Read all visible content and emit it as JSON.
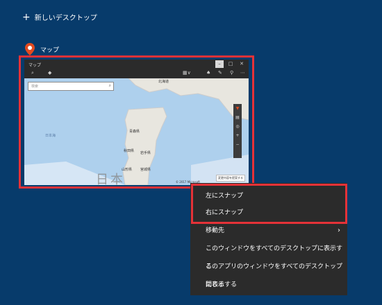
{
  "new_desktop": {
    "label": "新しいデスクトップ",
    "icon": "plus-icon"
  },
  "window": {
    "app_name": "マップ",
    "app_icon": "location-pin-icon",
    "thumbnail": {
      "title": "マップ",
      "search_placeholder": "検索",
      "map_labels": {
        "hokkaido": "北海道",
        "japan_sea": "日本海",
        "aomori": "青森県",
        "akita": "秋田県",
        "iwate": "岩手県",
        "yamagata": "山形県",
        "miyagi": "宮城県",
        "japan": "日本"
      },
      "feedback_button": "変更内容を提案する",
      "copyright": "© 2017 Microsoft"
    }
  },
  "context_menu": {
    "items": [
      {
        "label": "左にスナップ"
      },
      {
        "label": "右にスナップ"
      },
      {
        "label": "移動先",
        "submenu": true
      },
      {
        "label": "このウィンドウをすべてのデスクトップに表示する"
      },
      {
        "label": "このアプリのウィンドウをすべてのデスクトップに表示する"
      },
      {
        "label": "閉じる"
      }
    ]
  },
  "colors": {
    "background": "#073b6b",
    "highlight": "#e53238",
    "menu_bg": "#2b2b2b"
  }
}
